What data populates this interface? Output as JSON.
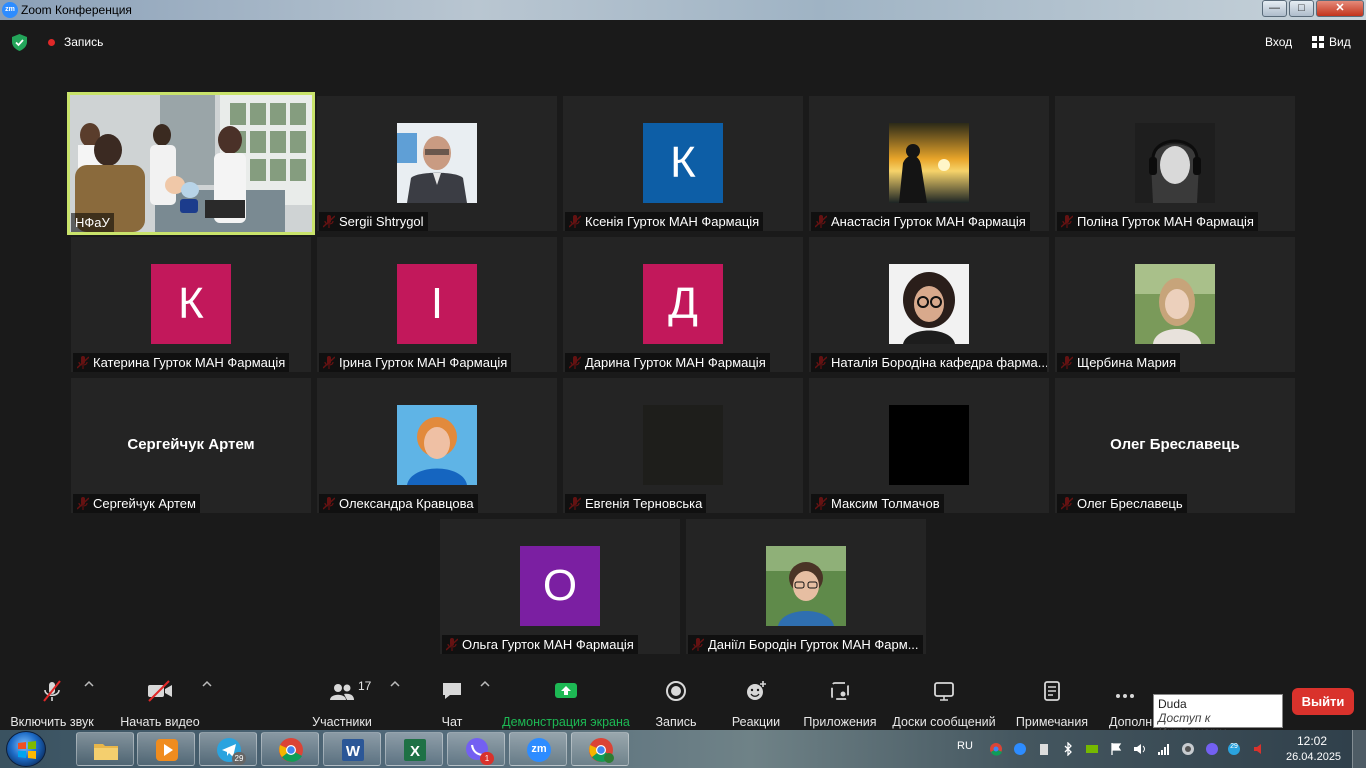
{
  "window": {
    "title": "Zoom Конференция",
    "app_icon_text": "zm"
  },
  "topbar": {
    "recording_label": "Запись",
    "exit_label": "Вход",
    "view_label": "Вид"
  },
  "participants": [
    {
      "name": "НФаУ",
      "active_speaker": true,
      "muted": false,
      "video": "classroom"
    },
    {
      "name": "Sergii Shtrygol",
      "muted": true,
      "video": "photo-man"
    },
    {
      "name": "Ксенія Гурток МАН Фармація",
      "muted": true,
      "letter": "К",
      "avatar_color": "#0d5ea6"
    },
    {
      "name": "Анастасія Гурток МАН Фармація",
      "muted": true,
      "video": "sunset"
    },
    {
      "name": "Поліна Гурток МАН Фармація",
      "muted": true,
      "video": "photo-headphones"
    },
    {
      "name": "Катерина Гурток МАН Фармація",
      "muted": true,
      "letter": "К",
      "avatar_color": "#c2185b"
    },
    {
      "name": "Ірина Гурток МАН Фармація",
      "muted": true,
      "letter": "І",
      "avatar_color": "#c2185b"
    },
    {
      "name": "Дарина Гурток МАН Фармація",
      "muted": true,
      "letter": "Д",
      "avatar_color": "#c2185b"
    },
    {
      "name": "Наталія Бородіна кафедра фарма...",
      "muted": true,
      "video": "photo-woman-glasses"
    },
    {
      "name": "Щербина Мария",
      "muted": true,
      "video": "photo-woman-park"
    },
    {
      "name": "Сергейчук Артем",
      "muted": true,
      "display_name_large": "Сергейчук Артем"
    },
    {
      "name": "Олександра Кравцова",
      "muted": true,
      "video": "photo-woman-blue"
    },
    {
      "name": "Евгенія Терновська",
      "muted": true,
      "video": "dark"
    },
    {
      "name": "Максим Толмачов",
      "muted": true,
      "video": "black"
    },
    {
      "name": "Олег Бреславець",
      "muted": true,
      "display_name_large": "Олег Бреславець"
    },
    {
      "name": "Ольга Гурток МАН Фармація",
      "muted": true,
      "letter": "О",
      "avatar_color": "#7b1fa2"
    },
    {
      "name": "Даніїл Бородін Гурток МАН Фарм...",
      "muted": true,
      "video": "photo-boy"
    }
  ],
  "toolbar": {
    "unmute_label": "Включить звук",
    "start_video_label": "Начать видео",
    "participants_label": "Участники",
    "participants_count": "17",
    "chat_label": "Чат",
    "share_label": "Демонстрация экрана",
    "record_label": "Запись",
    "reactions_label": "Реакции",
    "apps_label": "Приложения",
    "whiteboards_label": "Доски сообщений",
    "notes_label": "Примечания",
    "more_label": "Дополн",
    "leave_label": "Выйти"
  },
  "tooltip": {
    "title": "Duda",
    "subtitle": "Доступ к Интернету"
  },
  "taskbar": {
    "telegram_badge": "29",
    "viber_badge": "1",
    "zoom_icon_text": "zm",
    "tray_language": "RU",
    "tray_badge": "29",
    "time": "12:02",
    "date": "26.04.2025"
  },
  "colors": {
    "accent_green": "#1db954",
    "leave_red": "#d9322c",
    "active_border": "#c9e36b",
    "background": "#1a1a1a"
  }
}
